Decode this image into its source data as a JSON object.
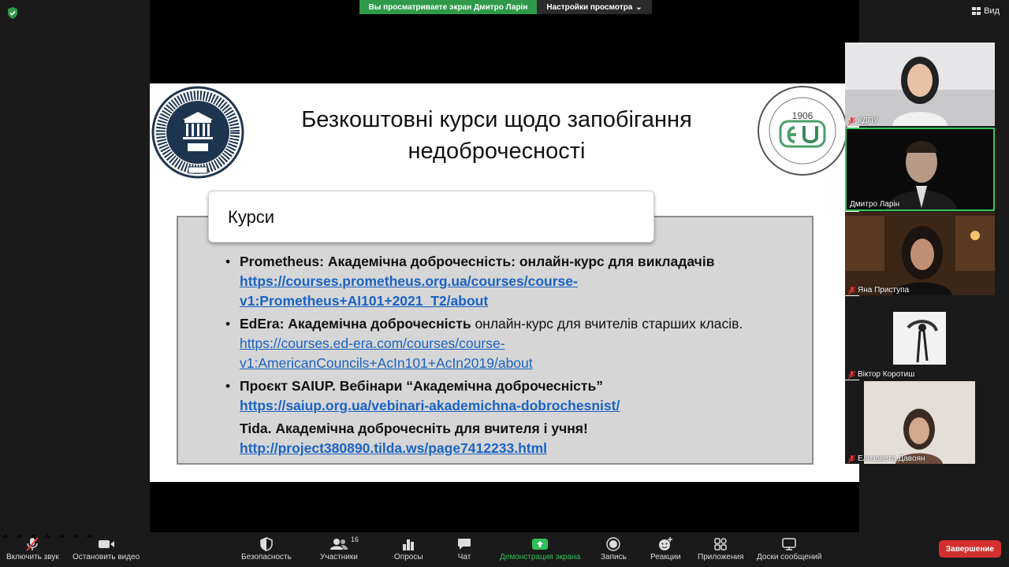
{
  "topbar": {
    "viewing_banner": "Вы просматриваете экран Дмитро Ларін",
    "view_options": "Настройки просмотра",
    "view_button": "Вид"
  },
  "slide": {
    "title_line1": "Безкоштовні курси щодо запобігання",
    "title_line2": "недоброчесності",
    "section_label": "Курси",
    "items": [
      {
        "bold": "Prometheus: Академічна доброчесність: онлайн-курс для викладачів",
        "text": "",
        "link": "https://courses.prometheus.org.ua/courses/course-v1:Prometheus+AI101+2021_T2/about"
      },
      {
        "bold": "EdEra: Академічна доброчесність",
        "text": " онлайн-курс для вчителів старших класів.",
        "link": "https://courses.ed-era.com/courses/course-v1:AmericanCouncils+AcIn101+AcIn2019/about"
      },
      {
        "bold": "Проєкт SAIUP. Вебінари “Академічна доброчесність”",
        "text": "",
        "link": "https://saiup.org.ua/vebinari-akademichna-dobrochesnist/"
      },
      {
        "bold": "Tida. Академічна доброчесніть для вчителя і учня!",
        "text": "",
        "link": "http://project380890.tilda.ws/page7412233.html"
      }
    ],
    "logo_right_year": "1906"
  },
  "participants": [
    {
      "name": "КДПУ",
      "muted": true
    },
    {
      "name": "Дмитро Ларін",
      "muted": false
    },
    {
      "name": "Яна Приступа",
      "muted": true
    },
    {
      "name": "Віктор Коротиш",
      "muted": true
    },
    {
      "name": "Елизавета Давоян",
      "muted": true
    }
  ],
  "toolbar": {
    "unmute": "Включить звук",
    "stop_video": "Остановить видео",
    "security": "Безопасность",
    "participants": "Участники",
    "participants_count": "16",
    "polls": "Опросы",
    "chat": "Чат",
    "share_screen": "Демонстрация экрана",
    "record": "Запись",
    "reactions": "Реакции",
    "apps": "Приложения",
    "whiteboards": "Доски сообщений",
    "end": "Завершение"
  },
  "colors": {
    "banner_green": "#2e9a4a",
    "end_red": "#d32f2f",
    "link_blue": "#1a63c4",
    "active_speaker_border": "#34c759"
  }
}
